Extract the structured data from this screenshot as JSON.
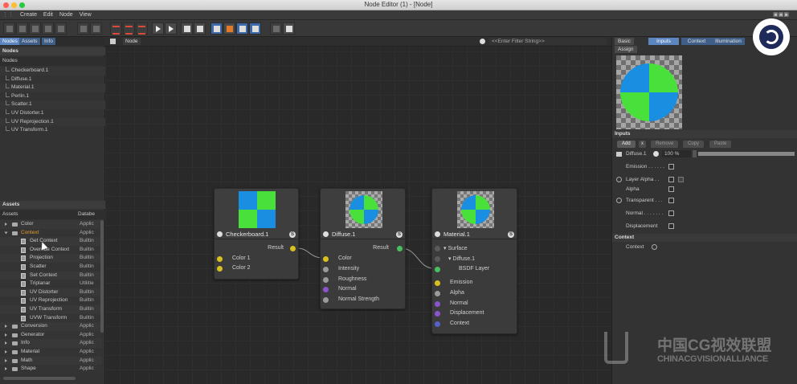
{
  "window": {
    "title": "Node Editor (1) - [Node]"
  },
  "menu": [
    "Create",
    "Edit",
    "Node",
    "View"
  ],
  "left_panel": {
    "tabs": [
      "Nodes",
      "Assets",
      "Info"
    ],
    "nodes_section": "Nodes",
    "nodes_header": "Nodes",
    "nodes": [
      "Checkerboard.1",
      "Diffuse.1",
      "Material.1",
      "Perlin.1",
      "Scatter.1",
      "UV Distorter.1",
      "UV Reprojection.1",
      "UV Transform.1"
    ],
    "assets_section": "Assets",
    "assets_columns": [
      "Assets",
      "Databe"
    ],
    "assets": [
      {
        "name": "Color",
        "db": "Applic",
        "kind": "folder",
        "highlight": false
      },
      {
        "name": "Context",
        "db": "Applic",
        "kind": "folder",
        "highlight": true
      },
      {
        "name": "Get Context",
        "db": "Builtin",
        "kind": "item",
        "highlight": false
      },
      {
        "name": "Override Context",
        "db": "Builtin",
        "kind": "item",
        "highlight": false
      },
      {
        "name": "Projection",
        "db": "Builtin",
        "kind": "item",
        "highlight": false
      },
      {
        "name": "Scatter",
        "db": "Builtin",
        "kind": "item",
        "highlight": false
      },
      {
        "name": "Set Context",
        "db": "Builtin",
        "kind": "item",
        "highlight": false
      },
      {
        "name": "Triplanar",
        "db": "Utilitie",
        "kind": "item",
        "highlight": false
      },
      {
        "name": "UV Distorter",
        "db": "Builtin",
        "kind": "item",
        "highlight": false
      },
      {
        "name": "UV Reprojection",
        "db": "Builtin",
        "kind": "item",
        "highlight": false
      },
      {
        "name": "UV Transform",
        "db": "Builtin",
        "kind": "item",
        "highlight": false
      },
      {
        "name": "UVW Transform",
        "db": "Builtin",
        "kind": "item",
        "highlight": false
      },
      {
        "name": "Conversion",
        "db": "Applic",
        "kind": "folder",
        "highlight": false
      },
      {
        "name": "Generator",
        "db": "Applic",
        "kind": "folder",
        "highlight": false
      },
      {
        "name": "Info",
        "db": "Applic",
        "kind": "folder",
        "highlight": false
      },
      {
        "name": "Material",
        "db": "Applic",
        "kind": "folder",
        "highlight": false
      },
      {
        "name": "Math",
        "db": "Applic",
        "kind": "folder",
        "highlight": false
      },
      {
        "name": "Shape",
        "db": "Applic",
        "kind": "folder",
        "highlight": false
      }
    ]
  },
  "canvas": {
    "breadcrumb": "Node",
    "filter_placeholder": "<<Enter Filter String>>",
    "nodes": {
      "checkerboard": {
        "title": "Checkerboard.1",
        "result": "Result",
        "inputs": [
          "Color 1",
          "Color 2"
        ],
        "solo": "S"
      },
      "diffuse": {
        "title": "Diffuse.1",
        "result": "Result",
        "inputs": [
          "Color",
          "Intensity",
          "Roughness",
          "Normal",
          "Normal Strength"
        ],
        "solo": "S"
      },
      "material": {
        "title": "Material.1",
        "surface": "Surface",
        "diffuse_ref": "Diffuse.1",
        "bsdf": "BSDF Layer",
        "inputs": [
          "Emission",
          "Alpha",
          "Normal",
          "Displacement",
          "Context"
        ],
        "solo": "S"
      }
    }
  },
  "right_panel": {
    "tabs": [
      "Basic",
      "Inputs",
      "Context",
      "Illumination"
    ],
    "tab2": "Assign",
    "inputs_section": "Inputs",
    "buttons": [
      "Add",
      "x",
      "Remove",
      "Copy",
      "Paste"
    ],
    "layer": {
      "name": "Diffuse.1",
      "value": "100 %"
    },
    "props": [
      "Emission . . . . . .",
      "Layer Alpha . .",
      "Alpha",
      "Transparent . . .",
      "Normal . . . . . . .",
      "Displacement"
    ],
    "context_section": "Context",
    "context_label": "Context"
  },
  "watermark": {
    "line1": "中国CG视效联盟",
    "line2": "CHINACGVISIONALLIANCE"
  },
  "colors": {
    "accent": "#5b86bf",
    "port_yellow": "#d8c020",
    "port_green": "#49c060",
    "port_purple": "#8a55cc",
    "highlight_orange": "#e0a030"
  }
}
